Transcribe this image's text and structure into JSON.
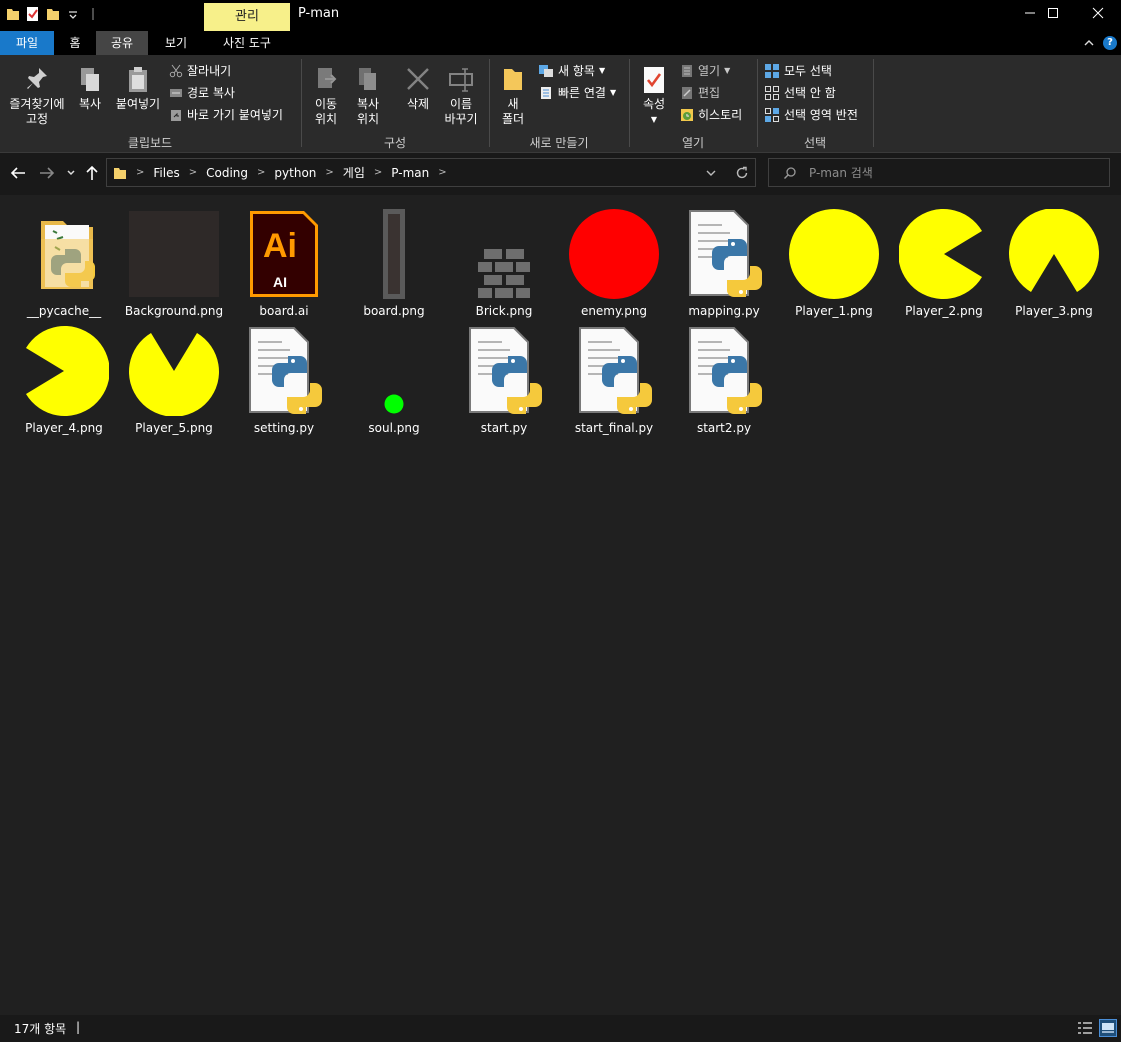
{
  "window": {
    "title": "P-man",
    "manage_tab": "관리",
    "minimize": "—",
    "maximize": "☐",
    "close": "✕"
  },
  "ribbon_tabs": {
    "file": "파일",
    "home": "홈",
    "share": "공유",
    "view": "보기",
    "picture_tools": "사진 도구",
    "help": "?"
  },
  "ribbon": {
    "clipboard": {
      "label": "클립보드",
      "pin_line1": "즐겨찾기에",
      "pin_line2": "고정",
      "copy": "복사",
      "paste": "붙여넣기",
      "cut": "잘라내기",
      "copy_path": "경로 복사",
      "paste_shortcut": "바로 가기 붙여넣기"
    },
    "organize": {
      "label": "구성",
      "move_line1": "이동",
      "move_line2": "위치",
      "copy_line1": "복사",
      "copy_line2": "위치",
      "delete": "삭제",
      "rename_line1": "이름",
      "rename_line2": "바꾸기"
    },
    "new": {
      "label": "새로 만들기",
      "folder_line1": "새",
      "folder_line2": "폴더",
      "new_item": "새 항목",
      "easy_access": "빠른 연결"
    },
    "open": {
      "label": "열기",
      "properties": "속성",
      "open": "열기",
      "edit": "편집",
      "history": "히스토리"
    },
    "select": {
      "label": "선택",
      "select_all": "모두 선택",
      "select_none": "선택 안 함",
      "invert": "선택 영역 반전"
    }
  },
  "address": {
    "crumbs": [
      "Files",
      "Coding",
      "python",
      "게임",
      "P-man"
    ],
    "search_placeholder": "P-man 검색"
  },
  "files": [
    {
      "name": "__pycache__",
      "kind": "folder-python"
    },
    {
      "name": "Background.png",
      "kind": "dark-square"
    },
    {
      "name": "board.ai",
      "kind": "ai"
    },
    {
      "name": "board.png",
      "kind": "board-strip"
    },
    {
      "name": "Brick.png",
      "kind": "brick"
    },
    {
      "name": "enemy.png",
      "kind": "red-circle"
    },
    {
      "name": "mapping.py",
      "kind": "python"
    },
    {
      "name": "Player_1.png",
      "kind": "pac-full"
    },
    {
      "name": "Player_2.png",
      "kind": "pac-left"
    },
    {
      "name": "Player_3.png",
      "kind": "pac-up"
    },
    {
      "name": "Player_4.png",
      "kind": "pac-right"
    },
    {
      "name": "Player_5.png",
      "kind": "pac-down"
    },
    {
      "name": "setting.py",
      "kind": "python"
    },
    {
      "name": "soul.png",
      "kind": "green-dot"
    },
    {
      "name": "start.py",
      "kind": "python"
    },
    {
      "name": "start_final.py",
      "kind": "python"
    },
    {
      "name": "start2.py",
      "kind": "python"
    }
  ],
  "status": {
    "count": "17개 항목",
    "caret": "|"
  },
  "colors": {
    "accent_blue": "#1979ca",
    "manage_tab": "#f7f08a",
    "pacman_yellow": "#ffff00",
    "enemy_red": "#ff0000",
    "soul_green": "#00ff00"
  }
}
